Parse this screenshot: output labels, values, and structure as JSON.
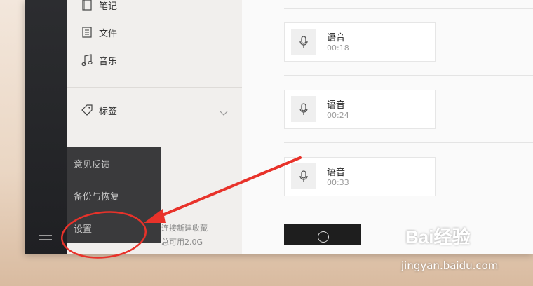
{
  "nav": {
    "items": [
      {
        "label": "笔记",
        "icon": "note-icon"
      },
      {
        "label": "文件",
        "icon": "file-icon"
      },
      {
        "label": "音乐",
        "icon": "music-icon"
      }
    ],
    "tags_label": "标签",
    "footer_line1": "连接新建收藏",
    "footer_line2": "总可用2.0G"
  },
  "popup_menu": {
    "items": [
      "意见反馈",
      "备份与恢复",
      "设置"
    ]
  },
  "content": {
    "voice_items": [
      {
        "title": "语音",
        "duration": "00:18"
      },
      {
        "title": "语音",
        "duration": "00:24"
      },
      {
        "title": "语音",
        "duration": "00:33"
      }
    ]
  },
  "watermark": {
    "logo": "Bai经验",
    "site": "jingyan.baidu.com"
  },
  "colors": {
    "annotation": "#e8322a",
    "sidebar_dark": "#2c2d30",
    "popup_bg": "#3a3a3c"
  }
}
